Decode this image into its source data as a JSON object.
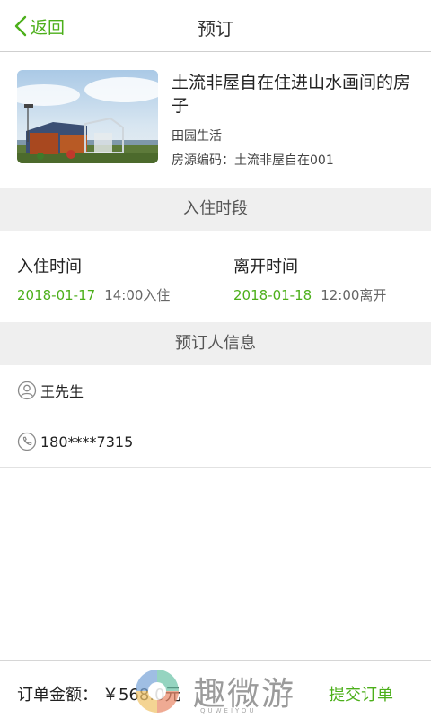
{
  "header": {
    "back_label": "返回",
    "title": "预订"
  },
  "listing": {
    "name": "土流非屋自在住进山水画间的房子",
    "category": "田园生活",
    "code": "房源编码：土流非屋自在001"
  },
  "stay": {
    "section_title": "入住时段",
    "checkin_label": "入住时间",
    "checkin_date": "2018-01-17",
    "checkin_time": "14:00入住",
    "checkout_label": "离开时间",
    "checkout_date": "2018-01-18",
    "checkout_time": "12:00离开"
  },
  "guest": {
    "section_title": "预订人信息",
    "name": "王先生",
    "phone": "180****7315"
  },
  "footer": {
    "total_label": "订单金额：",
    "total_value": "￥568.0元",
    "submit_label": "提交订单"
  },
  "watermark": {
    "text": "趣微游",
    "sub": "QUWEIYOU"
  },
  "colors": {
    "accent": "#4caf1a",
    "section_bg": "#efefef"
  }
}
